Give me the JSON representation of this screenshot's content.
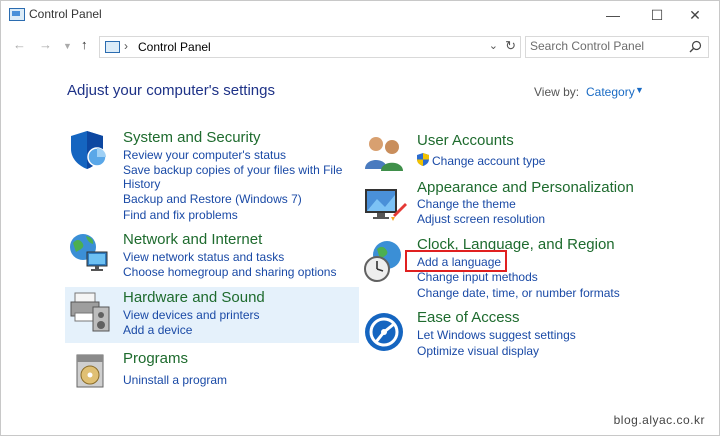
{
  "window": {
    "title": "Control Panel"
  },
  "address": {
    "path": "Control Panel"
  },
  "search": {
    "placeholder": "Search Control Panel"
  },
  "page": {
    "heading": "Adjust your computer's settings",
    "view_by_label": "View by:",
    "view_by_value": "Category"
  },
  "categories": {
    "system_security": {
      "title": "System and Security",
      "links": [
        "Review your computer's status",
        "Save backup copies of your files with File",
        "History",
        "Backup and Restore (Windows 7)",
        "Find and fix problems"
      ]
    },
    "network": {
      "title": "Network and Internet",
      "links": [
        "View network status and tasks",
        "Choose homegroup and sharing options"
      ]
    },
    "hardware": {
      "title": "Hardware and Sound",
      "links": [
        "View devices and printers",
        "Add a device"
      ]
    },
    "programs": {
      "title": "Programs",
      "links": [
        "Uninstall a program"
      ]
    },
    "user_accounts": {
      "title": "User Accounts",
      "links": [
        "Change account type"
      ]
    },
    "appearance": {
      "title": "Appearance and Personalization",
      "links": [
        "Change the theme",
        "Adjust screen resolution"
      ]
    },
    "clock_language": {
      "title": "Clock, Language, and Region",
      "links": [
        "Add a language",
        "Change input methods",
        "Change date, time, or number formats"
      ]
    },
    "ease": {
      "title": "Ease of Access",
      "links": [
        "Let Windows suggest settings",
        "Optimize visual display"
      ]
    }
  },
  "watermark": "blog.alyac.co.kr",
  "colors": {
    "accent": "#1a6bc4",
    "category_title": "#1e6b2e",
    "highlight": "#e5f1fb",
    "annotation": "#e02020"
  }
}
